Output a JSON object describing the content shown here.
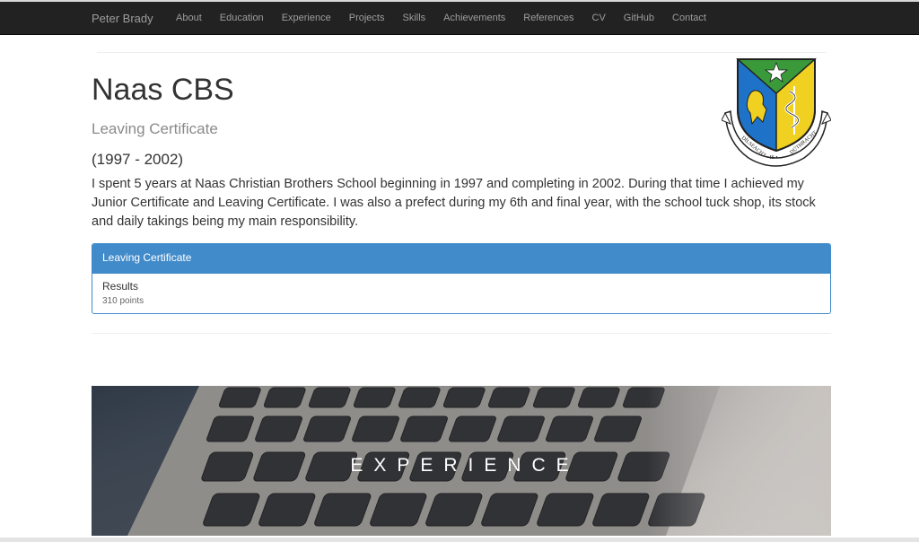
{
  "navbar": {
    "brand": "Peter Brady",
    "items": [
      "About",
      "Education",
      "Experience",
      "Projects",
      "Skills",
      "Achievements",
      "References",
      "CV",
      "GitHub",
      "Contact"
    ]
  },
  "school": {
    "title": "Naas CBS",
    "subtitle": "Leaving Certificate",
    "years": "(1997 - 2002)",
    "description": "I spent 5 years at Naas Christian Brothers School beginning in 1997 and completing in 2002. During that time I achieved my Junior Certificate and Leaving Certificate. I was also a prefect during my 6th and final year, with the school tuck shop, its stock and daily takings being my main responsibility.",
    "crest_motto": "DÍLSEACHT • IS • DÚTHRACHT"
  },
  "panel": {
    "heading": "Leaving Certificate",
    "result_label": "Results",
    "result_value": "310 points"
  },
  "hero": {
    "title": "EXPERIENCE"
  },
  "colors": {
    "navbar_bg": "#222222",
    "nav_text": "#9d9d9d",
    "panel_primary": "#428bca",
    "crest_blue": "#1e72c8",
    "crest_yellow": "#f0d020",
    "crest_green": "#3a9a3a"
  }
}
